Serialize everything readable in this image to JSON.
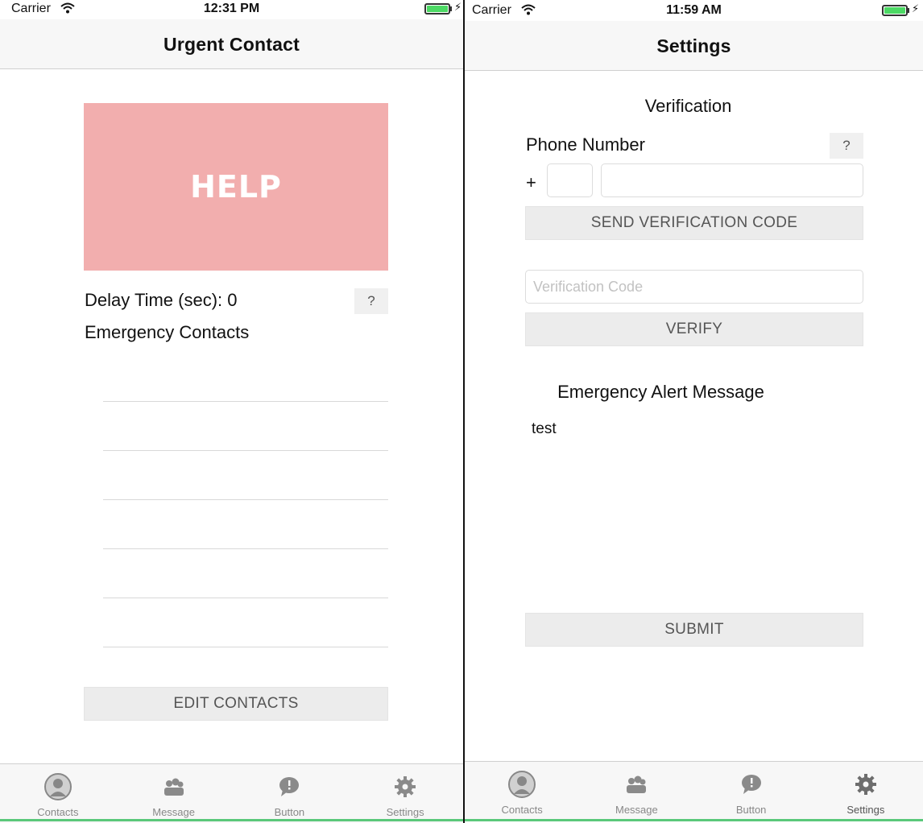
{
  "left": {
    "status": {
      "carrier": "Carrier",
      "time": "12:31 PM"
    },
    "nav_title": "Urgent Contact",
    "help_label": "HELP",
    "delay_label": "Delay Time (sec): 0",
    "help_question": "?",
    "contacts_heading": "Emergency Contacts",
    "contact_rows": [
      "",
      "",
      "",
      "",
      "",
      ""
    ],
    "edit_contacts_label": "EDIT CONTACTS",
    "tabs": [
      {
        "label": "Contacts",
        "icon": "contacts-icon"
      },
      {
        "label": "Message",
        "icon": "message-icon"
      },
      {
        "label": "Button",
        "icon": "button-icon"
      },
      {
        "label": "Settings",
        "icon": "settings-icon"
      }
    ]
  },
  "right": {
    "status": {
      "carrier": "Carrier",
      "time": "11:59 AM"
    },
    "nav_title": "Settings",
    "verification_title": "Verification",
    "phone_label": "Phone Number",
    "phone_question": "?",
    "plus_sign": "+",
    "country_code_value": "",
    "phone_value": "",
    "send_code_label": "SEND VERIFICATION CODE",
    "verification_placeholder": "Verification Code",
    "verify_label": "VERIFY",
    "alert_title": "Emergency Alert Message",
    "alert_message": "test",
    "submit_label": "SUBMIT",
    "tabs": [
      {
        "label": "Contacts",
        "icon": "contacts-icon"
      },
      {
        "label": "Message",
        "icon": "message-icon"
      },
      {
        "label": "Button",
        "icon": "button-icon"
      },
      {
        "label": "Settings",
        "icon": "settings-icon"
      }
    ]
  },
  "colors": {
    "help_button": "#f2aeae",
    "battery": "#4cd964",
    "bottom_accent": "#5ac87a"
  }
}
